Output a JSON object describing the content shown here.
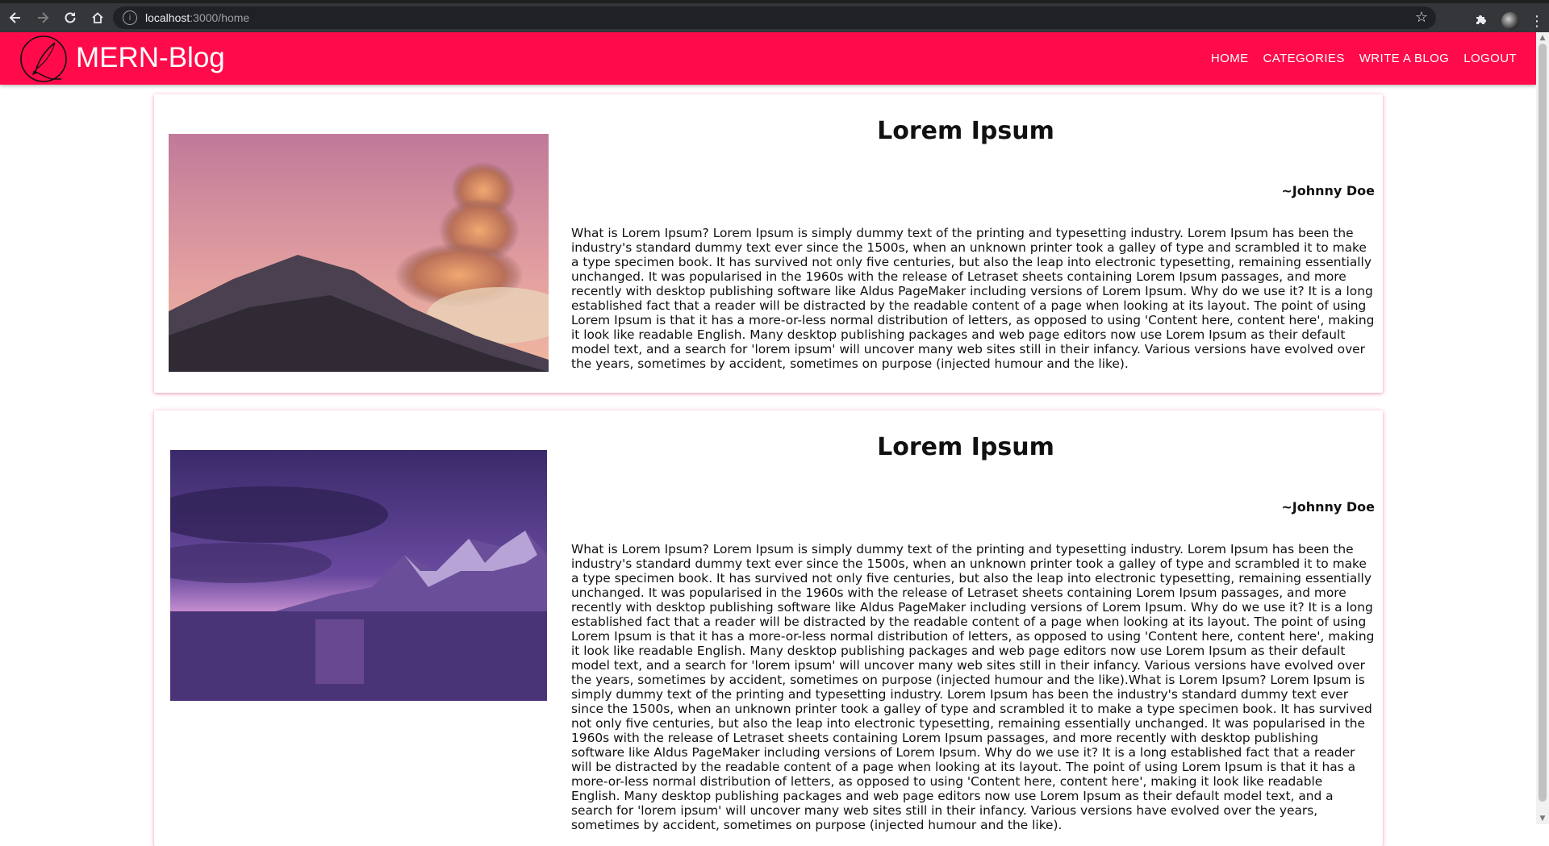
{
  "browser": {
    "url_host": "localhost",
    "url_path": ":3000/home"
  },
  "app": {
    "brand": "MERN-Blog",
    "nav": [
      "HOME",
      "CATEGORIES",
      "WRITE A BLOG",
      "LOGOUT"
    ]
  },
  "posts": [
    {
      "title": "Lorem Ipsum",
      "author": "~Johnny Doe",
      "body": "What is Lorem Ipsum? Lorem Ipsum is simply dummy text of the printing and typesetting industry. Lorem Ipsum has been the industry's standard dummy text ever since the 1500s, when an unknown printer took a galley of type and scrambled it to make a type specimen book. It has survived not only five centuries, but also the leap into electronic typesetting, remaining essentially unchanged. It was popularised in the 1960s with the release of Letraset sheets containing Lorem Ipsum passages, and more recently with desktop publishing software like Aldus PageMaker including versions of Lorem Ipsum. Why do we use it? It is a long established fact that a reader will be distracted by the readable content of a page when looking at its layout. The point of using Lorem Ipsum is that it has a more-or-less normal distribution of letters, as opposed to using 'Content here, content here', making it look like readable English. Many desktop publishing packages and web page editors now use Lorem Ipsum as their default model text, and a search for 'lorem ipsum' will uncover many web sites still in their infancy. Various versions have evolved over the years, sometimes by accident, sometimes on purpose (injected humour and the like)."
    },
    {
      "title": "Lorem Ipsum",
      "author": "~Johnny Doe",
      "body": "What is Lorem Ipsum? Lorem Ipsum is simply dummy text of the printing and typesetting industry. Lorem Ipsum has been the industry's standard dummy text ever since the 1500s, when an unknown printer took a galley of type and scrambled it to make a type specimen book. It has survived not only five centuries, but also the leap into electronic typesetting, remaining essentially unchanged. It was popularised in the 1960s with the release of Letraset sheets containing Lorem Ipsum passages, and more recently with desktop publishing software like Aldus PageMaker including versions of Lorem Ipsum. Why do we use it? It is a long established fact that a reader will be distracted by the readable content of a page when looking at its layout. The point of using Lorem Ipsum is that it has a more-or-less normal distribution of letters, as opposed to using 'Content here, content here', making it look like readable English. Many desktop publishing packages and web page editors now use Lorem Ipsum as their default model text, and a search for 'lorem ipsum' will uncover many web sites still in their infancy. Various versions have evolved over the years, sometimes by accident, sometimes on purpose (injected humour and the like).What is Lorem Ipsum? Lorem Ipsum is simply dummy text of the printing and typesetting industry. Lorem Ipsum has been the industry's standard dummy text ever since the 1500s, when an unknown printer took a galley of type and scrambled it to make a type specimen book. It has survived not only five centuries, but also the leap into electronic typesetting, remaining essentially unchanged. It was popularised in the 1960s with the release of Letraset sheets containing Lorem Ipsum passages, and more recently with desktop publishing software like Aldus PageMaker including versions of Lorem Ipsum. Why do we use it? It is a long established fact that a reader will be distracted by the readable content of a page when looking at its layout. The point of using Lorem Ipsum is that it has a more-or-less normal distribution of letters, as opposed to using 'Content here, content here', making it look like readable English. Many desktop publishing packages and web page editors now use Lorem Ipsum as their default model text, and a search for 'lorem ipsum' will uncover many web sites still in their infancy. Various versions have evolved over the years, sometimes by accident, sometimes on purpose (injected humour and the like)."
    }
  ],
  "colors": {
    "appbar": "#ff0a4a",
    "chrome": "#35363a"
  },
  "icons": {
    "back": "arrow-left-icon",
    "forward": "arrow-right-icon",
    "reload": "reload-icon",
    "home": "home-icon",
    "bookmark": "star-icon",
    "extensions": "puzzle-icon",
    "menu": "kebab-icon",
    "logo": "quill-logo-icon"
  }
}
